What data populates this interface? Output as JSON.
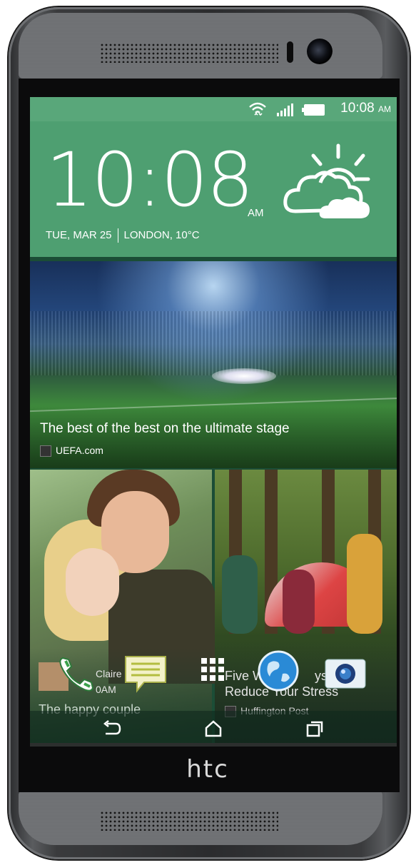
{
  "status_bar": {
    "time": "10:08",
    "ampm": "AM",
    "icons": [
      "wifi-icon",
      "signal-icon",
      "battery-icon"
    ]
  },
  "clock_widget": {
    "time": "10:08",
    "ampm": "AM",
    "date": "TUE, MAR 25",
    "location_temp": "LONDON, 10°C",
    "weather_icon": "sun-cloud-icon"
  },
  "news_card": {
    "headline": "The best of the best on the ultimate stage",
    "source": "UEFA.com"
  },
  "couple_card": {
    "notification_name": "Claire",
    "notification_time": "0AM",
    "caption": "The happy couple"
  },
  "article_card": {
    "title_line1": "Five W     ng     ys",
    "title_line2": "Reduce Your Stress",
    "source": "Huffington Post"
  },
  "dock": [
    "phone-icon",
    "messages-icon",
    "apps-icon",
    "browser-icon",
    "camera-icon"
  ],
  "nav": [
    "back-icon",
    "home-icon",
    "recents-icon"
  ],
  "brand": "htc",
  "colors": {
    "widget_green": "#4e9f71",
    "status_green": "#59a77a",
    "bezel": "#2b2c2e"
  }
}
